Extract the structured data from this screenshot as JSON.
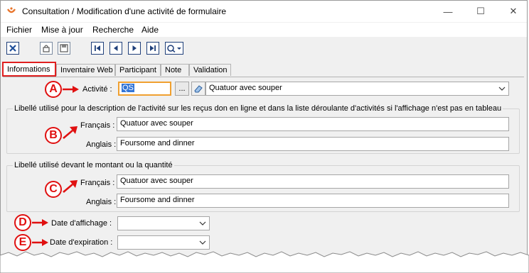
{
  "window": {
    "title": "Consultation / Modification d'une activité de formulaire",
    "minimize_glyph": "—",
    "maximize_glyph": "☐",
    "close_glyph": "✕"
  },
  "menu": {
    "items": [
      "Fichier",
      "Mise à jour",
      "Recherche",
      "Aide"
    ]
  },
  "toolbar": {
    "icons": [
      "close-icon",
      "lock-icon",
      "save-icon",
      "first-record-icon",
      "previous-record-icon",
      "next-record-icon",
      "last-record-icon",
      "search-options-icon"
    ]
  },
  "tabs": {
    "items": [
      "Informations",
      "Inventaire Web",
      "Participant",
      "Note",
      "Validation"
    ],
    "active": "Informations"
  },
  "form": {
    "activite": {
      "label": "Activité :",
      "code": "QS",
      "browse_label": "...",
      "selected": "Quatuor avec souper"
    },
    "group_recus": {
      "title": "Libellé utilisé pour la description de l'activité sur les reçus don en ligne et dans la liste déroulante d'activités si l'affichage n'est pas en tableau",
      "francais_label": "Français :",
      "francais_value": "Quatuor avec souper",
      "anglais_label": "Anglais :",
      "anglais_value": "Foursome and dinner"
    },
    "group_montant": {
      "title": "Libellé utilisé devant le montant ou la quantité",
      "francais_label": "Français :",
      "francais_value": "Quatuor avec souper",
      "anglais_label": "Anglais :",
      "anglais_value": "Foursome and dinner"
    },
    "date_affichage": {
      "label": "Date d'affichage :",
      "value": ""
    },
    "date_expiration": {
      "label": "Date d'expiration :",
      "value": ""
    }
  },
  "markers": [
    "A",
    "B",
    "C",
    "D",
    "E"
  ],
  "colors": {
    "marker_red": "#e01010",
    "selection_blue": "#3375d6",
    "focus_orange": "#f0a030"
  }
}
